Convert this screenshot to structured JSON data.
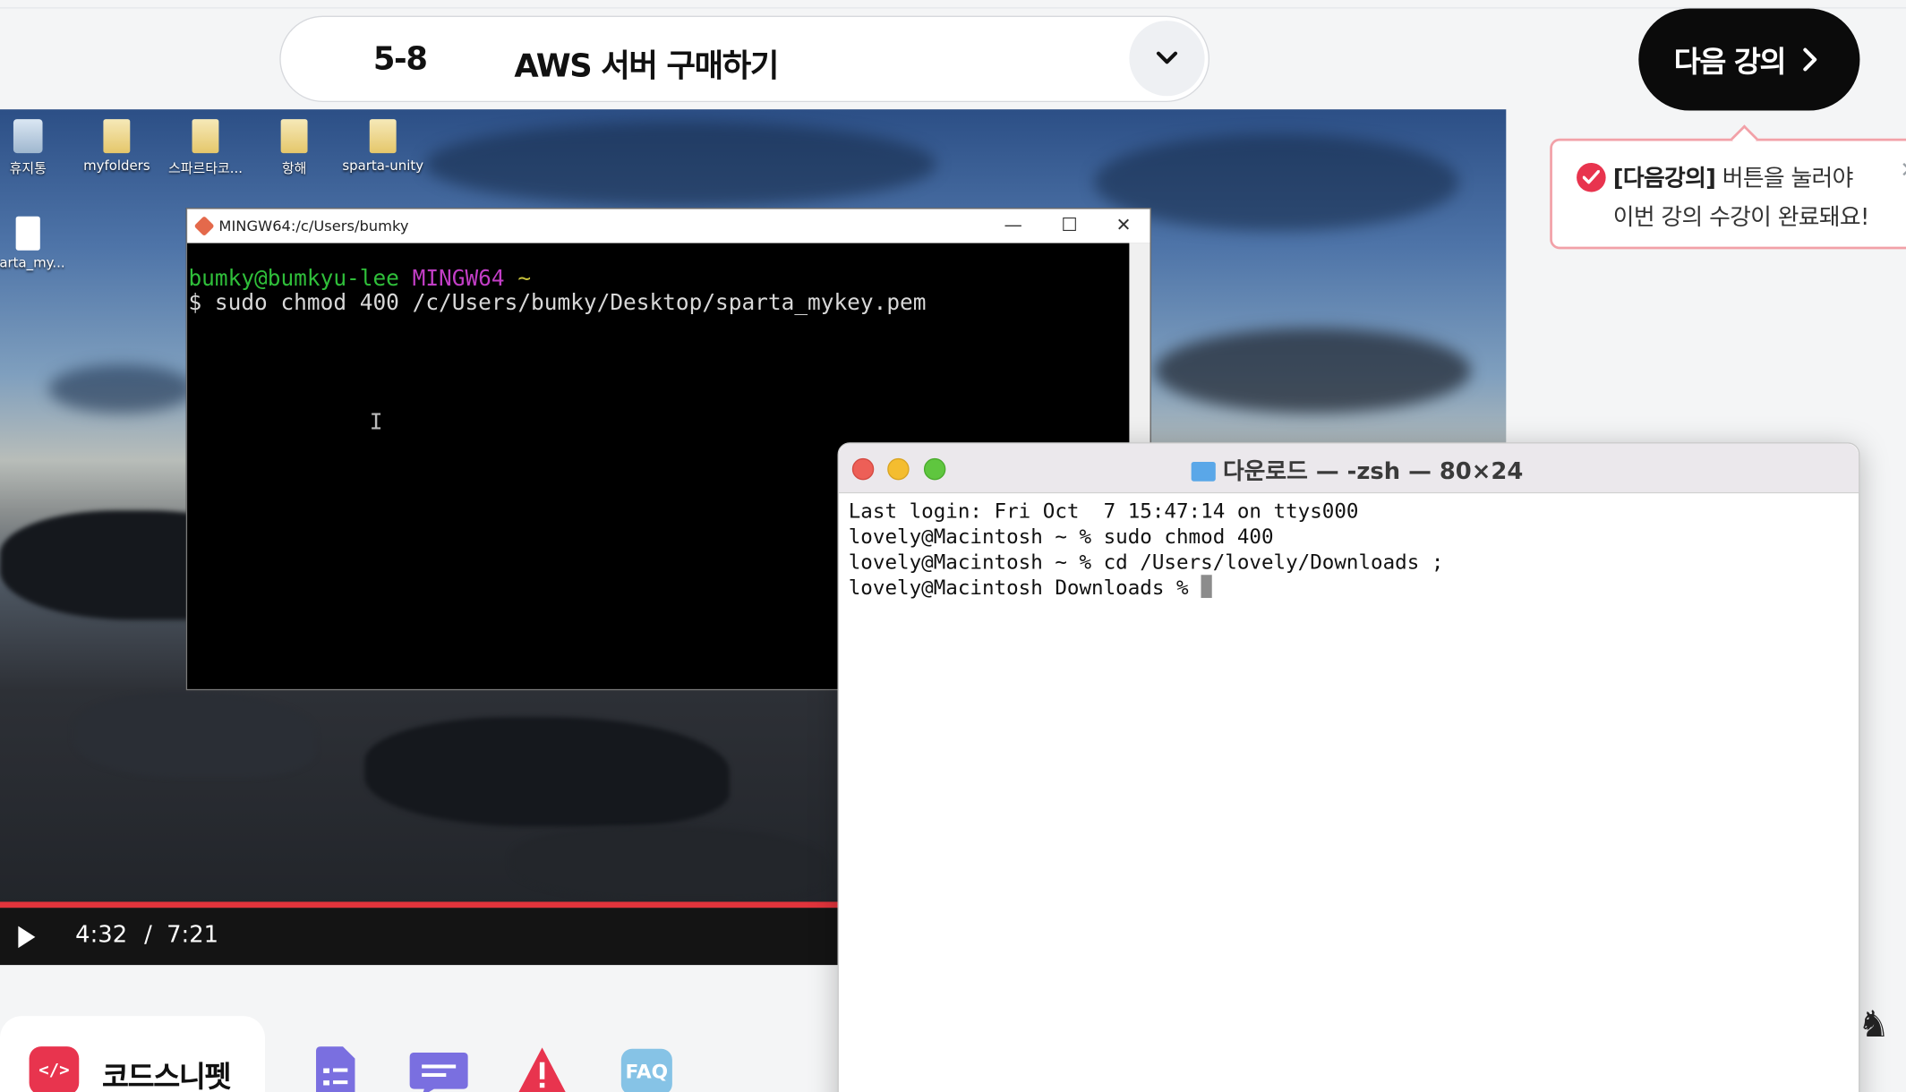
{
  "header": {
    "lecture_number": "5-8",
    "lecture_title": "AWS 서버 구매하기",
    "next_button": "다음 강의"
  },
  "tooltip": {
    "highlight": "[다음강의]",
    "line1_rest": " 버튼을 눌러야",
    "line2": "이번 강의 수강이 완료돼요!"
  },
  "video": {
    "current_time": "4:32",
    "separator": "/",
    "duration": "7:21",
    "progress_percent": 62,
    "desktop_icons": [
      {
        "label": "휴지통",
        "kind": "bin"
      },
      {
        "label": "myfolders",
        "kind": "folder"
      },
      {
        "label": "스파르타코...",
        "kind": "folder"
      },
      {
        "label": "항해",
        "kind": "folder"
      },
      {
        "label": "sparta-unity",
        "kind": "folder"
      },
      {
        "label": "parta_my...",
        "kind": "file"
      }
    ],
    "git_bash": {
      "title": "MINGW64:/c/Users/bumky",
      "prompt_user": "bumky@bumkyu-lee",
      "prompt_env": "MINGW64",
      "prompt_dir": "~",
      "command": "$ sudo chmod 400 /c/Users/bumky/Desktop/sparta_mykey.pem"
    }
  },
  "mac_terminal": {
    "title": "다운로드 — -zsh — 80×24",
    "lines": [
      "Last login: Fri Oct  7 15:47:14 on ttys000",
      "lovely@Macintosh ~ % sudo chmod 400",
      "lovely@Macintosh ~ % cd /Users/lovely/Downloads ;",
      "lovely@Macintosh Downloads % "
    ]
  },
  "toolbar": {
    "snippet_label": "코드스니펫",
    "snippet_icon": "</>",
    "faq_label": "FAQ"
  },
  "colors": {
    "accent": "#e8344e",
    "progress": "#e1343c",
    "git_green": "#2fbf3a",
    "git_magenta": "#c23ec6"
  }
}
